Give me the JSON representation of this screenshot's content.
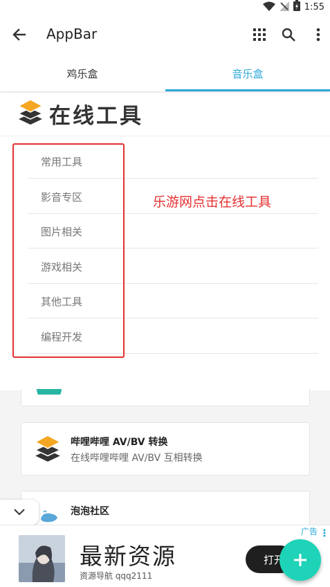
{
  "status_bar": {
    "time": "1:55",
    "icons": [
      "wifi-icon",
      "no-signal-icon",
      "battery-charging-icon"
    ]
  },
  "app_bar": {
    "title": "AppBar",
    "actions": [
      "back-arrow-icon",
      "grid-icon",
      "search-icon",
      "more-vert-icon"
    ]
  },
  "tabs": [
    {
      "label": "鸡乐盒",
      "active": false
    },
    {
      "label": "音乐盒",
      "active": true
    }
  ],
  "panel": {
    "brand": "在线工具",
    "menu": [
      {
        "label": "常用工具"
      },
      {
        "label": "影音专区"
      },
      {
        "label": "图片相关"
      },
      {
        "label": "游戏相关"
      },
      {
        "label": "其他工具"
      },
      {
        "label": "编程开发"
      }
    ],
    "annotation": "乐游网点击在线工具"
  },
  "cards": [
    {
      "title": "哔哩哔哩 AV/BV 转换",
      "desc": "在线哔哩哔哩 AV/BV 互相转换"
    },
    {
      "title": "泡泡社区",
      "desc": ""
    }
  ],
  "ad": {
    "tag": "广告",
    "headline": "最新资源",
    "sub": "资源导航 qqq2111",
    "button": "打开"
  },
  "colors": {
    "accent": "#29a8d8",
    "highlight": "#e53030",
    "fab": "#1fd3b8"
  }
}
